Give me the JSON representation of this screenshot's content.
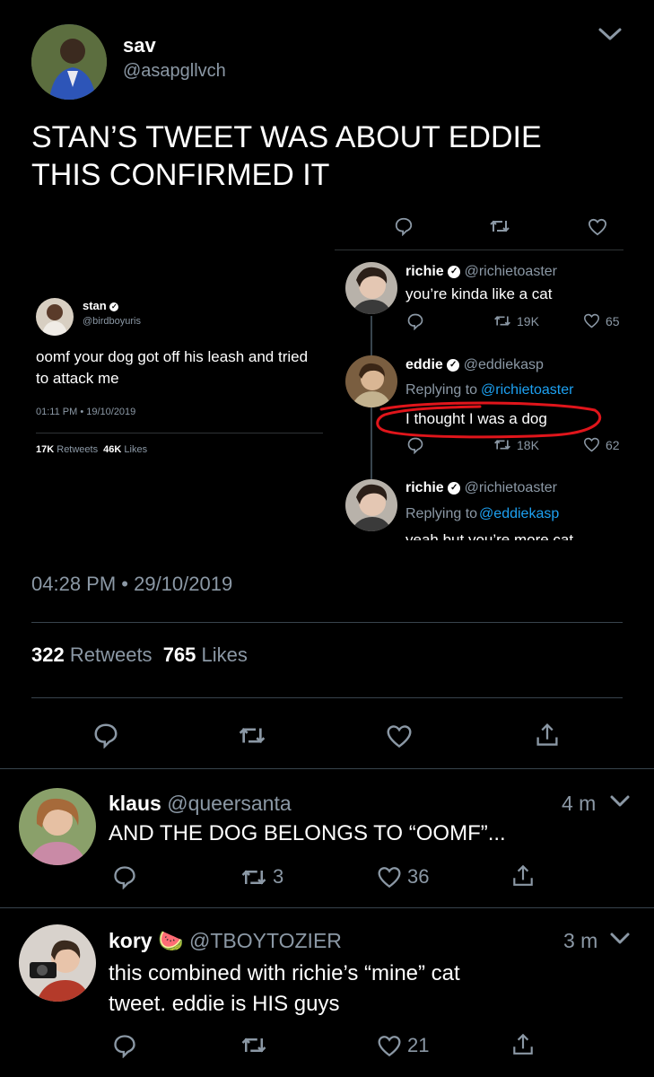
{
  "main_tweet": {
    "name": "sav",
    "handle": "@asapgllvch",
    "text_line1": "STAN’S TWEET WAS ABOUT EDDIE",
    "text_line2": "THIS CONFIRMED IT",
    "timestamp": "04:28 PM • 29/10/2019",
    "retweets_count": "322",
    "retweets_label": "Retweets",
    "likes_count": "765",
    "likes_label": "Likes"
  },
  "embedded_left": {
    "name": "stan",
    "handle": "@birdboyuris",
    "text": "oomf your dog got off his leash and tried to attack me",
    "timestamp": "01:11 PM • 19/10/2019",
    "retweets_count": "17K",
    "retweets_label": "Retweets",
    "likes_count": "46K",
    "likes_label": "Likes"
  },
  "embedded_right": {
    "tweet1": {
      "name": "richie",
      "handle": "@richietoaster",
      "text": "you’re kinda like a cat",
      "retweets": "19K",
      "likes": "65"
    },
    "tweet2": {
      "name": "eddie",
      "handle": "@eddiekasp",
      "replying_prefix": "Replying to",
      "replying_handle": "@richietoaster",
      "text": "I thought I was a dog",
      "retweets": "18K",
      "likes": "62"
    },
    "tweet3": {
      "name": "richie",
      "handle": "@richietoaster",
      "replying_prefix": "Replying to",
      "replying_handle": "@eddiekasp",
      "text_partial": "yeah but you’re more cat"
    }
  },
  "replies": [
    {
      "name": "klaus",
      "handle": "@queersanta",
      "time": "4 m",
      "text": "AND THE DOG BELONGS TO “OOMF”...",
      "retweets": "3",
      "likes": "36"
    },
    {
      "name": "kory",
      "emoji": "🍉",
      "handle": "@TBOYTOZIER",
      "time": "3 m",
      "text_line1": "this combined with richie’s “mine” cat",
      "text_line2": "tweet. eddie is HIS guys",
      "likes": "21"
    }
  ],
  "colors": {
    "background": "#000000",
    "divider": "#38444d",
    "secondary_text": "#8b98a5",
    "link_blue": "#1da1f2",
    "highlight_red": "#e0151b"
  },
  "icons": [
    "chevron-down-icon",
    "reply-icon",
    "retweet-icon",
    "like-icon",
    "share-icon",
    "verified-icon"
  ]
}
